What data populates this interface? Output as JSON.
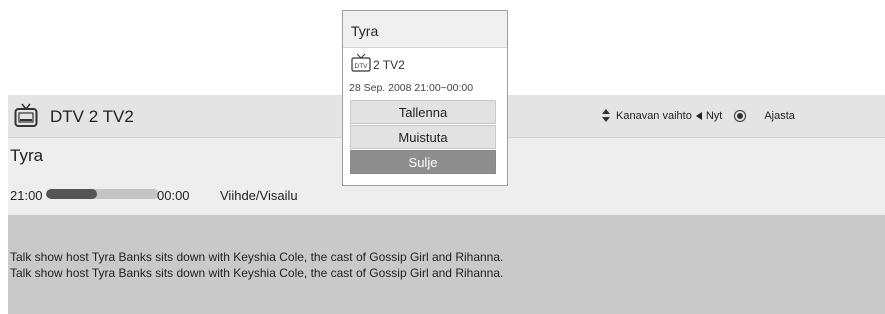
{
  "header": {
    "channel_title": "DTV 2  TV2",
    "hint_channel": "Kanavan vaihto",
    "hint_now": "Nyt",
    "hint_schedule": "Ajasta"
  },
  "program": {
    "title": "Tyra",
    "start_time": "21:00",
    "end_time": "00:00",
    "progress_fraction": 0.45,
    "genre": "Viihde/Visailu",
    "description": [
      "Talk show host Tyra Banks sits down with Keyshia Cole, the cast of Gossip Girl and Rihanna.",
      "Talk show host Tyra Banks sits down with Keyshia Cole, the cast of Gossip Girl and Rihanna."
    ]
  },
  "popup": {
    "title": "Tyra",
    "channel": "2 TV2",
    "dtv_badge": "DTV",
    "time": "28 Sep. 2008 21:00~00:00",
    "buttons": [
      "Tallenna",
      "Muistuta",
      "Sulje"
    ],
    "selected_button": "Sulje"
  },
  "icons": {
    "tv": "tv-icon",
    "updown": "up-down-arrows-icon",
    "left": "left-arrow-icon",
    "ok": "ok-button-icon"
  },
  "colors": {
    "header_bg": "#e4e4e4",
    "info_bg": "#eeeeee",
    "desc_bg": "#c9c9c9",
    "selected_button_bg": "#8e8e8e"
  }
}
